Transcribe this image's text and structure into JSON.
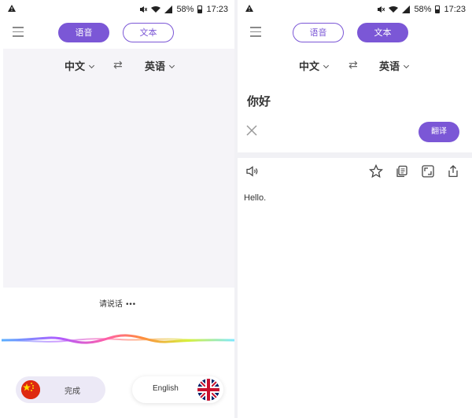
{
  "status_bar": {
    "battery": "58%",
    "time": "17:23"
  },
  "tabs": {
    "voice": "语音",
    "text": "文本"
  },
  "languages": {
    "source": "中文",
    "target": "英语"
  },
  "voice_screen": {
    "prompt": "请说话",
    "left_button": {
      "label": "完成",
      "flag": "china-flag"
    },
    "right_button": {
      "label": "English",
      "flag": "uk-flag"
    }
  },
  "text_screen": {
    "input_text": "你好",
    "translate_button": "翻译",
    "result_text": "Hello.",
    "toolbar_icons": [
      "speaker-icon",
      "star-icon",
      "copy-icon",
      "fullscreen-icon",
      "share-icon"
    ]
  },
  "colors": {
    "accent": "#7b57d6",
    "voice_area_bg": "#f5f4f8",
    "divider": "#f1f1f5"
  }
}
